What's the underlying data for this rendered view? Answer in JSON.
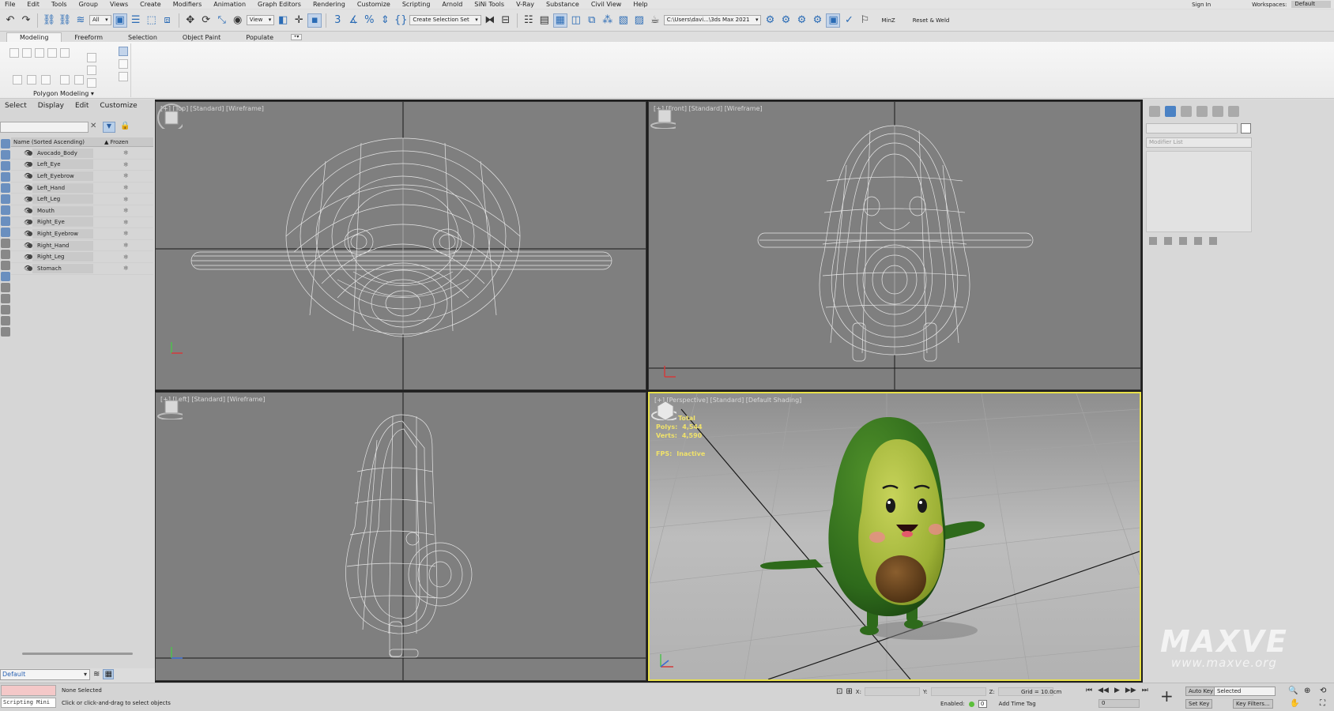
{
  "menubar": {
    "items": [
      "File",
      "Edit",
      "Tools",
      "Group",
      "Views",
      "Create",
      "Modifiers",
      "Animation",
      "Graph Editors",
      "Rendering",
      "Customize",
      "Scripting",
      "Arnold",
      "SiNi Tools",
      "V-Ray",
      "Substance",
      "Civil View",
      "Help"
    ],
    "sign_in": "Sign In",
    "workspaces_label": "Workspaces:",
    "workspace_value": "Default"
  },
  "toolbar": {
    "filter_value": "All",
    "view_value": "View",
    "selection_set": "Create Selection Set",
    "path": "C:\\Users\\davi...\\3ds Max 2021",
    "minz": "MinZ",
    "reset_weld": "Reset & Weld"
  },
  "ribbon": {
    "tabs": [
      "Modeling",
      "Freeform",
      "Selection",
      "Object Paint",
      "Populate"
    ],
    "group_label": "Polygon Modeling ▾"
  },
  "scene_explorer": {
    "menu": [
      "Select",
      "Display",
      "Edit",
      "Customize"
    ],
    "col_name": "Name (Sorted Ascending)",
    "col_frozen": "▲ Frozen",
    "objects": [
      "Avocado_Body",
      "Left_Eye",
      "Left_Eyebrow",
      "Left_Hand",
      "Left_Leg",
      "Mouth",
      "Right_Eye",
      "Right_Eyebrow",
      "Right_Hand",
      "Right_Leg",
      "Stomach"
    ]
  },
  "viewports": {
    "top_label": "[+] [Top] [Standard] [Wireframe]",
    "front_label": "[+] [Front] [Standard] [Wireframe]",
    "left_label": "[+] [Left] [Standard] [Wireframe]",
    "persp_label": "[+] [Perspective] [Standard] [Default Shading]",
    "stats": {
      "total": "Total",
      "polys_label": "Polys:",
      "polys_value": "4,544",
      "verts_label": "Verts:",
      "verts_value": "4,590",
      "fps_label": "FPS:",
      "fps_value": "Inactive"
    }
  },
  "command_panel": {
    "modifier_list": "Modifier List"
  },
  "layer": {
    "value": "Default"
  },
  "status": {
    "script_label": "Scripting Mini",
    "selection": "None Selected",
    "prompt": "Click or click-and-drag to select objects",
    "x_label": "X:",
    "y_label": "Y:",
    "z_label": "Z:",
    "grid": "Grid = 10.0cm",
    "enabled": "Enabled:",
    "enabled_value": "0",
    "add_time_tag": "Add Time Tag",
    "frame": "0",
    "auto_key": "Auto Key",
    "selected": "Selected",
    "set_key": "Set Key",
    "key_filters": "Key Filters..."
  },
  "watermark": {
    "big": "MAXVE",
    "small": "www.maxve.org"
  },
  "colors": {
    "viewport_bg": "#7f7f7f",
    "active_border": "#e8e04a",
    "avocado_skin": "#2f6a1c",
    "avocado_flesh": "#a4b83a",
    "avocado_pit": "#6e4a22"
  }
}
